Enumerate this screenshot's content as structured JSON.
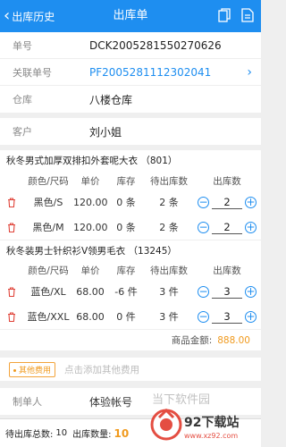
{
  "header": {
    "back_label": "出库历史",
    "title": "出库单"
  },
  "form": {
    "order_no_label": "单号",
    "order_no": "DCK2005281550270626",
    "related_label": "关联单号",
    "related_no": "PF2005281112302041",
    "warehouse_label": "仓库",
    "warehouse": "八楼仓库",
    "customer_label": "客户",
    "customer": "刘小姐"
  },
  "table_headers": {
    "color_size": "颜色/尺码",
    "price": "单价",
    "stock": "库存",
    "pending": "待出库数",
    "out": "出库数"
  },
  "products": [
    {
      "name": "秋冬男式加厚双排扣外套呢大衣 （801）",
      "rows": [
        {
          "color_size": "黑色/S",
          "price": "120.00",
          "stock": "0 条",
          "pending": "2 条",
          "qty": "2"
        },
        {
          "color_size": "黑色/M",
          "price": "120.00",
          "stock": "0 条",
          "pending": "2 条",
          "qty": "2"
        }
      ]
    },
    {
      "name": "秋冬装男士针织衫V领男毛衣 （13245）",
      "rows": [
        {
          "color_size": "蓝色/XL",
          "price": "68.00",
          "stock": "-6 件",
          "pending": "3 件",
          "qty": "3"
        },
        {
          "color_size": "蓝色/XXL",
          "price": "68.00",
          "stock": "0 件",
          "pending": "3 件",
          "qty": "3"
        }
      ]
    }
  ],
  "summary": {
    "amount_label": "商品金额:",
    "amount": "888.00"
  },
  "fees": {
    "badge": "其他费用",
    "hint": "点击添加其他费用"
  },
  "maker": {
    "label": "制单人",
    "value": "体验帐号"
  },
  "footer": {
    "total_label": "待出库总数:",
    "total": "10",
    "out_label": "出库数量:",
    "out": "10"
  },
  "watermark": {
    "text": "当下软件园",
    "site": "92下载站",
    "url": "www.xz92.com"
  },
  "colors": {
    "primary": "#1e8ef0",
    "accent": "#f09a1e",
    "danger": "#e0443a"
  }
}
